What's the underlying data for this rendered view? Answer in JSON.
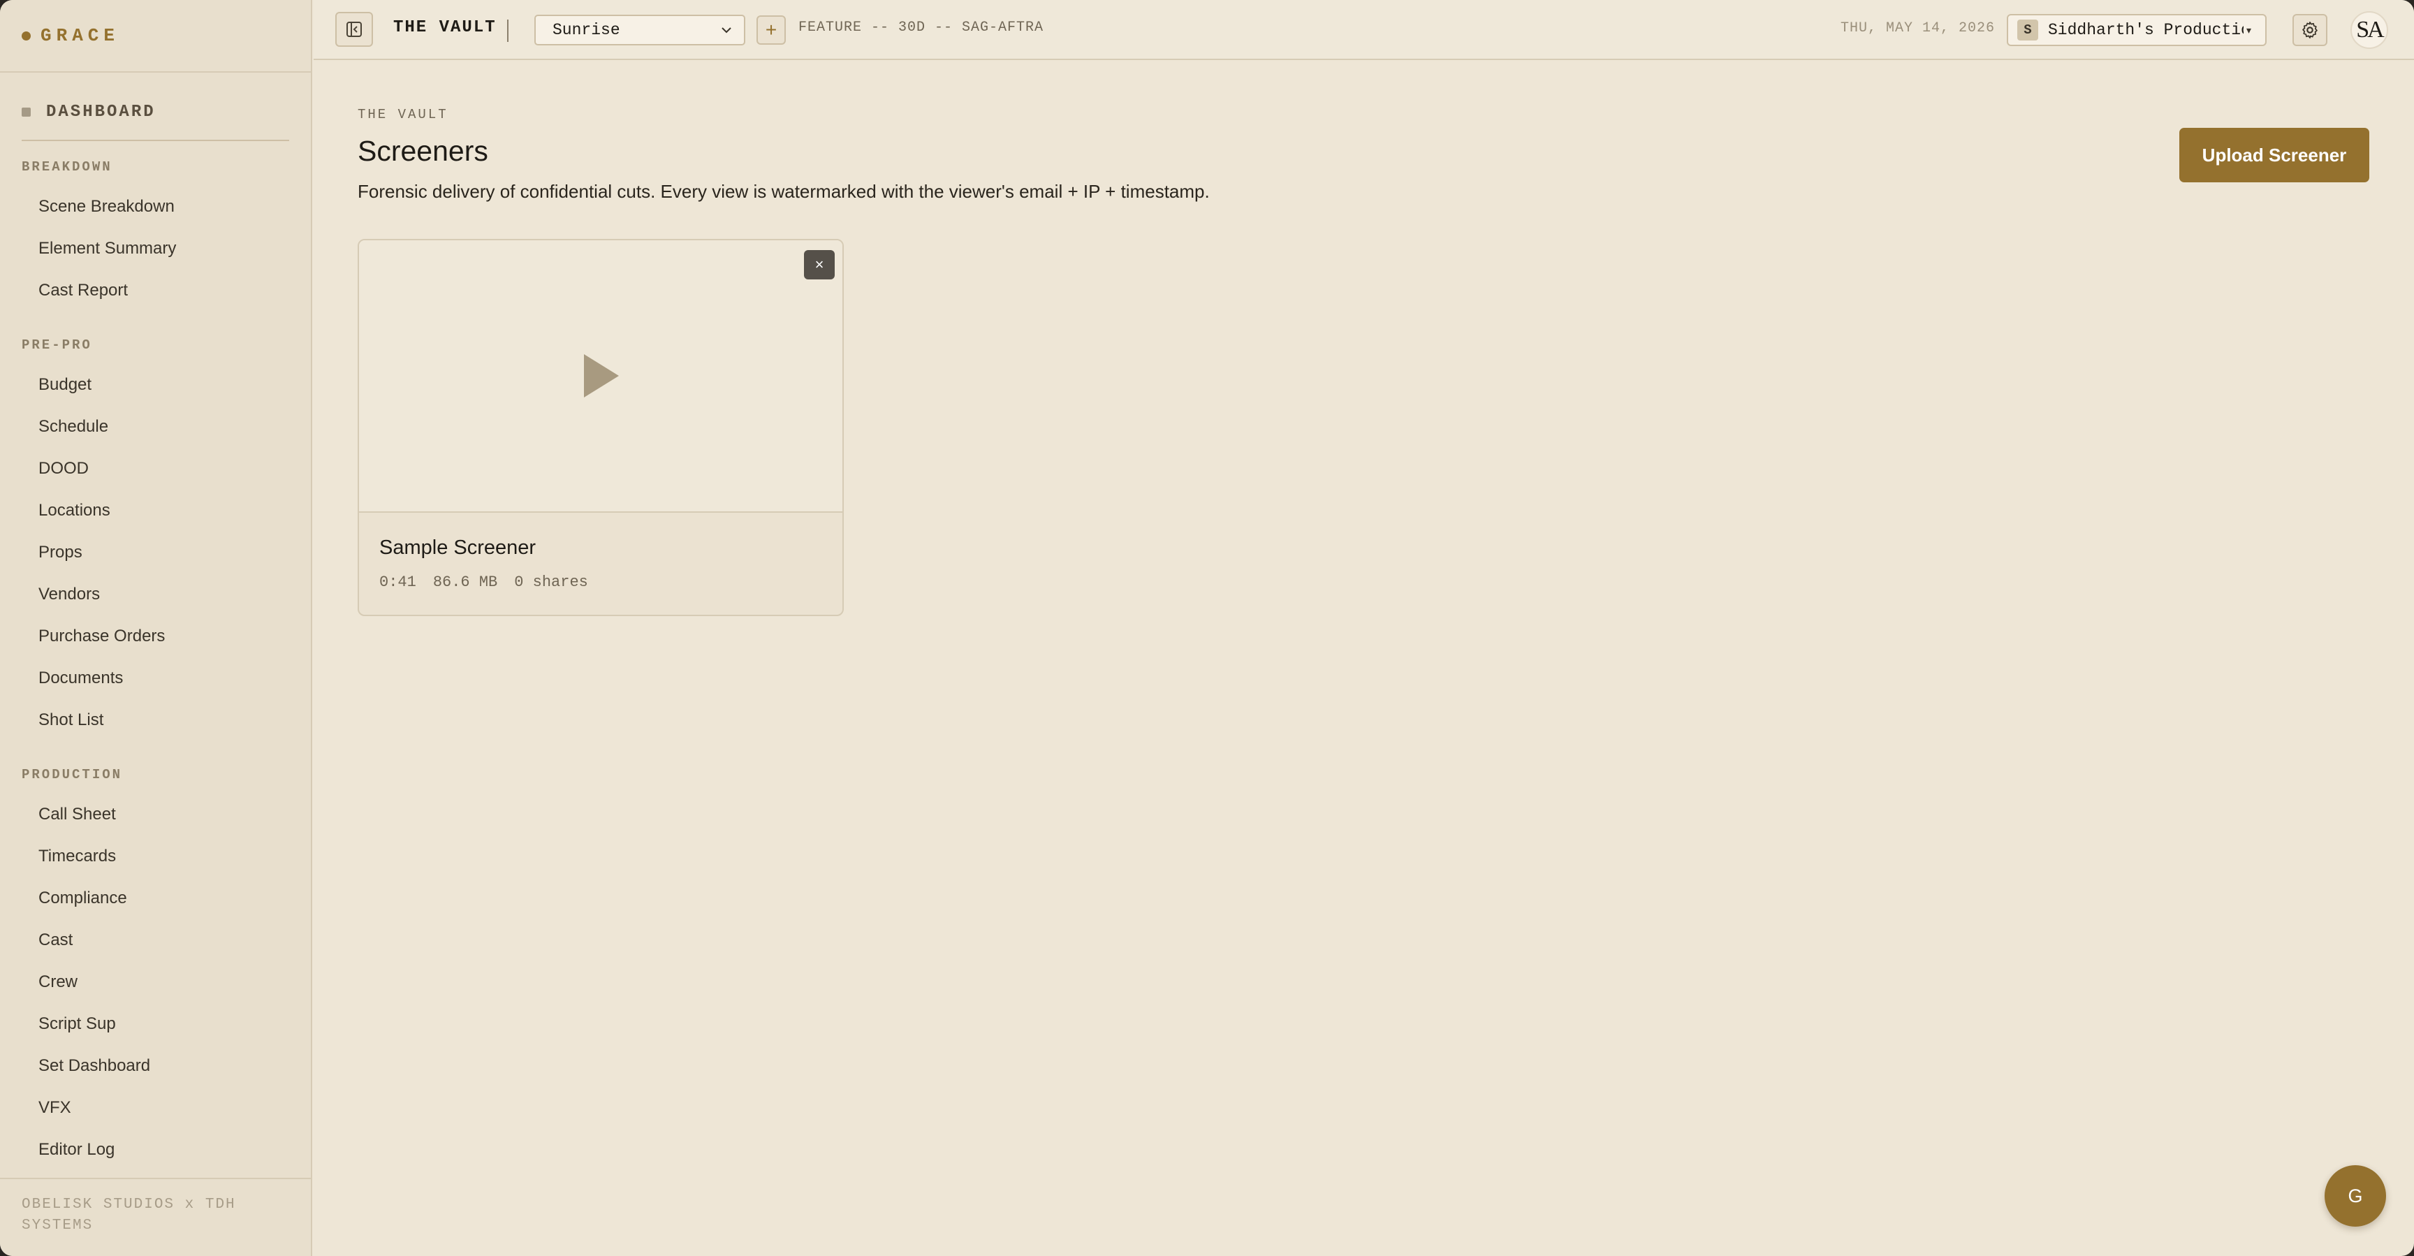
{
  "brand": {
    "name": "GRACE"
  },
  "sidebar": {
    "dashboard_label": "DASHBOARD",
    "sections": [
      {
        "label": "BREAKDOWN",
        "items": [
          "Scene Breakdown",
          "Element Summary",
          "Cast Report"
        ]
      },
      {
        "label": "PRE-PRO",
        "items": [
          "Budget",
          "Schedule",
          "DOOD",
          "Locations",
          "Props",
          "Vendors",
          "Purchase Orders",
          "Documents",
          "Shot List"
        ]
      },
      {
        "label": "PRODUCTION",
        "items": [
          "Call Sheet",
          "Timecards",
          "Compliance",
          "Cast",
          "Crew",
          "Script Sup",
          "Set Dashboard",
          "VFX",
          "Editor Log"
        ]
      }
    ],
    "footer": "OBELISK STUDIOS x TDH SYSTEMS"
  },
  "topbar": {
    "title": "THE VAULT",
    "project": "Sunrise",
    "add_label": "+",
    "project_meta": "FEATURE -- 30D -- SAG-AFTRA",
    "date": "THU, MAY 14, 2026",
    "org_initial": "S",
    "org_name": "Siddharth's Production",
    "org_caret": "▾",
    "avatar_initials": "SA"
  },
  "main": {
    "eyebrow": "THE VAULT",
    "title": "Screeners",
    "description": "Forensic delivery of confidential cuts. Every view is watermarked with the viewer's email + IP + timestamp.",
    "upload_button": "Upload Screener"
  },
  "screeners": [
    {
      "title": "Sample Screener",
      "duration": "0:41",
      "size": "86.6 MB",
      "shares": "0 shares",
      "close_label": "×"
    }
  ],
  "fab": {
    "label": "G"
  },
  "colors": {
    "accent": "#94712e",
    "background": "#eee6d6",
    "sidebar": "#e8dfcd"
  }
}
